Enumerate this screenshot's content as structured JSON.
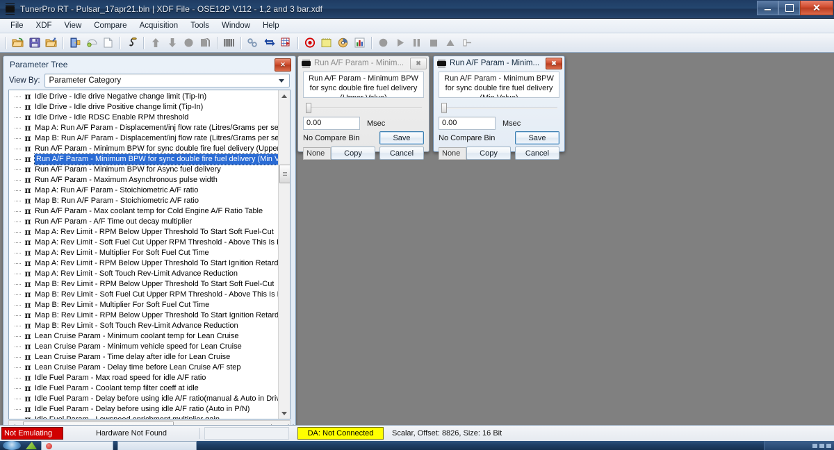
{
  "window": {
    "title": "TunerPro RT - Pulsar_17apr21.bin | XDF File - OSE12P V112 - 1,2 and 3 bar.xdf",
    "icon": "chip-icon",
    "minimize_label": "–",
    "maximize_label": "□",
    "close_label": "✕"
  },
  "menubar": {
    "items": [
      {
        "label": "File"
      },
      {
        "label": "XDF"
      },
      {
        "label": "View"
      },
      {
        "label": "Compare"
      },
      {
        "label": "Acquisition"
      },
      {
        "label": "Tools"
      },
      {
        "label": "Window"
      },
      {
        "label": "Help"
      }
    ]
  },
  "toolbar": {
    "buttons": [
      {
        "name": "open-bin-icon",
        "glyph": "📂",
        "color": "#e8a33d"
      },
      {
        "name": "save-bin-icon",
        "glyph": "💾",
        "color": "#6a64c8"
      },
      {
        "name": "open-recent-icon",
        "glyph": "📁",
        "color": "#e8a33d"
      },
      {
        "name": "open-xdf-icon",
        "glyph": "🚪",
        "color": "#3a63b8"
      },
      {
        "name": "close-xdf-icon",
        "glyph": "◖",
        "color": "#9fbf5a"
      },
      {
        "name": "new-file-icon",
        "glyph": "🗋",
        "color": "#f4f6f9"
      },
      {
        "name": "hook-icon",
        "glyph": "⌇",
        "color": "#2f2f2f"
      },
      {
        "name": "upload-icon",
        "glyph": "⬆",
        "color": "#8d8d8d"
      },
      {
        "name": "download-icon",
        "glyph": "⬇",
        "color": "#8d8d8d"
      },
      {
        "name": "circle-icon",
        "glyph": "⬤",
        "color": "#8d8d8d"
      },
      {
        "name": "copy-pages-icon",
        "glyph": "❐",
        "color": "#8d8d8d"
      },
      {
        "name": "hex-editor-icon",
        "glyph": "▓",
        "color": "#6b6b6b"
      },
      {
        "name": "compare-tools-icon",
        "glyph": "⚭",
        "color": "#7f97b5"
      },
      {
        "name": "swap-icon",
        "glyph": "⇄",
        "color": "#1c44a8"
      },
      {
        "name": "grid-flag-icon",
        "glyph": "▦",
        "color": "#c22020"
      },
      {
        "name": "record-stop-icon",
        "glyph": "◎",
        "color": "#d40000"
      },
      {
        "name": "notes-icon",
        "glyph": "▤",
        "color": "#e8e26a"
      },
      {
        "name": "gauge-icon",
        "glyph": "◔",
        "color": "#e8a33d"
      },
      {
        "name": "bar-chart-icon",
        "glyph": "📊",
        "color": "#4aa84a"
      },
      {
        "name": "record-icon",
        "glyph": "⬤",
        "color": "#9a9a9a"
      },
      {
        "name": "play-icon",
        "glyph": "▶",
        "color": "#9a9a9a"
      },
      {
        "name": "pause-icon",
        "glyph": "⏸",
        "color": "#9a9a9a"
      },
      {
        "name": "stop-icon",
        "glyph": "■",
        "color": "#9a9a9a"
      },
      {
        "name": "eject-icon",
        "glyph": "▲",
        "color": "#9a9a9a"
      },
      {
        "name": "slider-icon",
        "glyph": "⌶",
        "color": "#9a9a9a"
      }
    ]
  },
  "parameter_tree": {
    "title": "Parameter Tree",
    "close_label": "✕",
    "view_by_label": "View By:",
    "view_by_value": "Parameter Category",
    "selected_index": 6,
    "items": [
      "Idle Drive - Idle drive Negative change limit (Tip-In)",
      "Idle Drive - Idle drive Positive change limit (Tip-In)",
      "Idle Drive - Idle RDSC Enable RPM threshold",
      "Map A: Run A/F Param - Displacement/inj flow rate (Litres/Grams per sec)",
      "Map B: Run A/F Param - Displacement/inj flow rate (Litres/Grams per sec)",
      "Run A/F Param - Minimum BPW for sync double fire fuel delivery (Upper Value)",
      "Run A/F Param - Minimum BPW for sync double fire fuel delivery (Min Value)",
      "Run A/F Param - Minimum BPW for Async fuel delivery",
      "Run A/F Param - Maximum Asynchronous pulse width",
      "Map A: Run A/F Param - Stoichiometric A/F ratio",
      "Map B: Run A/F Param - Stoichiometric A/F ratio",
      "Run A/F Param - Max coolant temp for Cold Engine A/F Ratio Table",
      "Run A/F Param - A/F Time out decay multiplier",
      "Map A: Rev Limit - RPM Below Upper Threshold To Start Soft Fuel-Cut",
      "Map A: Rev Limit - Soft Fuel Cut Upper RPM Threshold - Above This Is Hard Fue",
      "Map A: Rev Limit - Multiplier For Soft Fuel Cut Time",
      "Map A: Rev Limit - RPM Below Upper Threshold To Start Ignition Retard",
      "Map A: Rev Limit - Soft Touch Rev-Limit Advance Reduction",
      "Map B: Rev Limit - RPM Below Upper Threshold To Start Soft Fuel-Cut",
      "Map B: Rev Limit - Soft Fuel Cut Upper RPM Threshold - Above This Is Hard Fue",
      "Map B: Rev Limit - Multiplier For Soft Fuel Cut Time",
      "Map B: Rev Limit - RPM Below Upper Threshold To Start Ignition Retard",
      "Map B: Rev Limit - Soft Touch Rev-Limit Advance Reduction",
      "Lean Cruise Param - Minimum coolant temp for Lean Cruise",
      "Lean Cruise Param - Minimum vehicle speed for Lean Cruise",
      "Lean Cruise Param - Time delay after idle for Lean Cruise",
      "Lean Cruise Param - Delay time before Lean Cruise A/F step",
      "Idle Fuel Param - Max road speed for idle A/F ratio",
      "Idle Fuel Param - Coolant temp filter coeff at idle",
      "Idle Fuel Param - Delay before using idle A/F ratio(manual & Auto in Drive)",
      "Idle Fuel Param - Delay before using idle A/F ratio (Auto in P/N)",
      "Idle Fuel Param - Lowspeed enrichment multiplier gain"
    ],
    "node_glyph": "π"
  },
  "dialogs": [
    {
      "active": false,
      "title": "Run A/F Param - Minim...",
      "close_label": "✖",
      "description": "Run A/F Param - Minimum BPW for sync double fire fuel delivery (Upper Value)",
      "value": "0.00",
      "unit": "Msec",
      "compare_label": "No Compare Bin",
      "compare_value": "None",
      "save_label": "Save",
      "copy_label": "Copy",
      "cancel_label": "Cancel"
    },
    {
      "active": true,
      "title": "Run A/F Param - Minim...",
      "close_label": "✖",
      "description": "Run A/F Param - Minimum BPW for sync double fire fuel delivery (Min Value)",
      "value": "0.00",
      "unit": "Msec",
      "compare_label": "No Compare Bin",
      "compare_value": "None",
      "save_label": "Save",
      "copy_label": "Copy",
      "cancel_label": "Cancel"
    }
  ],
  "statusbar": {
    "emulation": "Not Emulating",
    "hardware": "Hardware Not Found",
    "blank": "",
    "da": "DA: Not Connected",
    "info": "Scalar, Offset: 8826,  Size: 16 Bit"
  },
  "colors": {
    "accent_blue": "#2a6bd4",
    "title_bar": "#1f3c63",
    "status_error_bg": "#d00000",
    "status_warn_bg": "#ffff00",
    "mdi_background": "#808080"
  },
  "taskbar": {
    "start_label": "",
    "items": [
      {
        "name": "taskbar-item-tunerpro",
        "label": ""
      },
      {
        "name": "taskbar-item-window",
        "label": ""
      }
    ]
  }
}
